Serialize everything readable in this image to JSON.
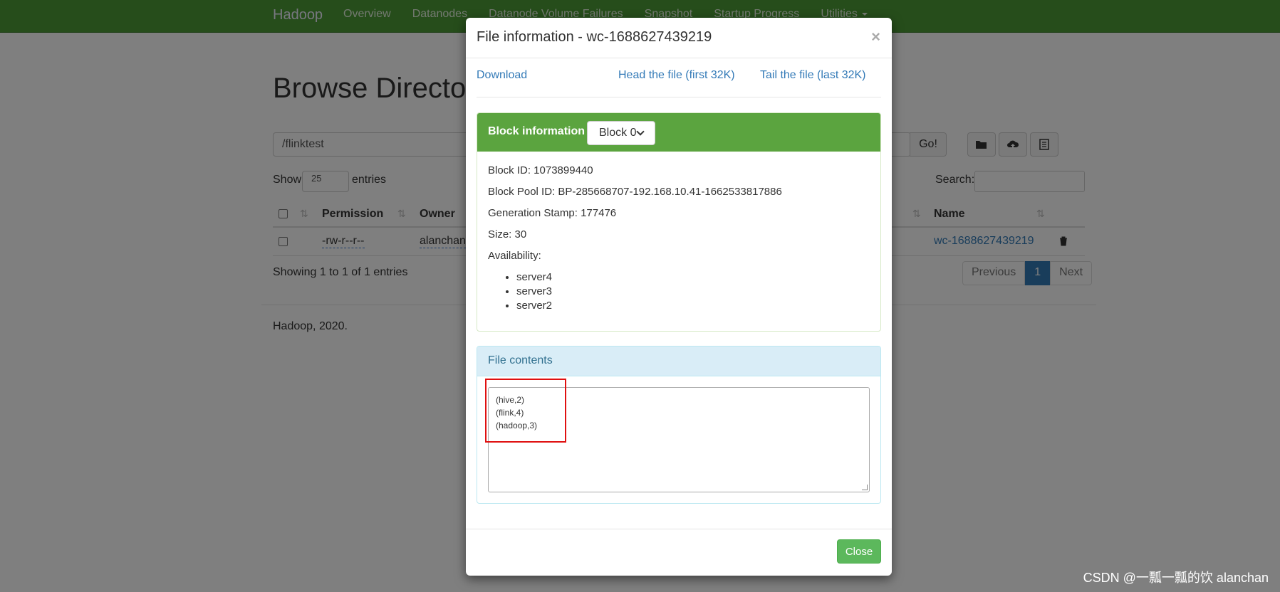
{
  "navbar": {
    "brand": "Hadoop",
    "items": [
      "Overview",
      "Datanodes",
      "Datanode Volume Failures",
      "Snapshot",
      "Startup Progress",
      "Utilities"
    ]
  },
  "page": {
    "title": "Browse Directory",
    "path_value": "/flinktest",
    "go_label": "Go!",
    "show_label": "Show",
    "page_size": "25",
    "entries_label": "entries",
    "search_label": "Search:",
    "columns": [
      "Permission",
      "Owner",
      "Name"
    ],
    "row": {
      "permission": "-rw-r--r--",
      "owner": "alanchan",
      "name": "wc-1688627439219"
    },
    "showing": "Showing 1 to 1 of 1 entries",
    "pager": {
      "previous": "Previous",
      "current": "1",
      "next": "Next"
    },
    "footer": "Hadoop, 2020."
  },
  "modal": {
    "title": "File information - wc-1688627439219",
    "close_x": "×",
    "links": {
      "download": "Download",
      "head": "Head the file (first 32K)",
      "tail": "Tail the file (last 32K)"
    },
    "block_panel": {
      "title": "Block information --",
      "selected_block": "Block 0",
      "block_id": "Block ID: 1073899440",
      "block_pool_id": "Block Pool ID: BP-285668707-192.168.10.41-1662533817886",
      "generation_stamp": "Generation Stamp: 177476",
      "size": "Size: 30",
      "availability_label": "Availability:",
      "servers": [
        "server4",
        "server3",
        "server2"
      ]
    },
    "contents_panel": {
      "title": "File contents",
      "lines": [
        "(hive,2)",
        "(flink,4)",
        "(hadoop,3)"
      ]
    },
    "close_label": "Close"
  },
  "watermark": "CSDN @一瓢一瓢的饮 alanchan",
  "colors": {
    "navbar": "#4d9a36",
    "block_header": "#5ba43f",
    "highlight": "#e01010",
    "link": "#337ab7"
  }
}
